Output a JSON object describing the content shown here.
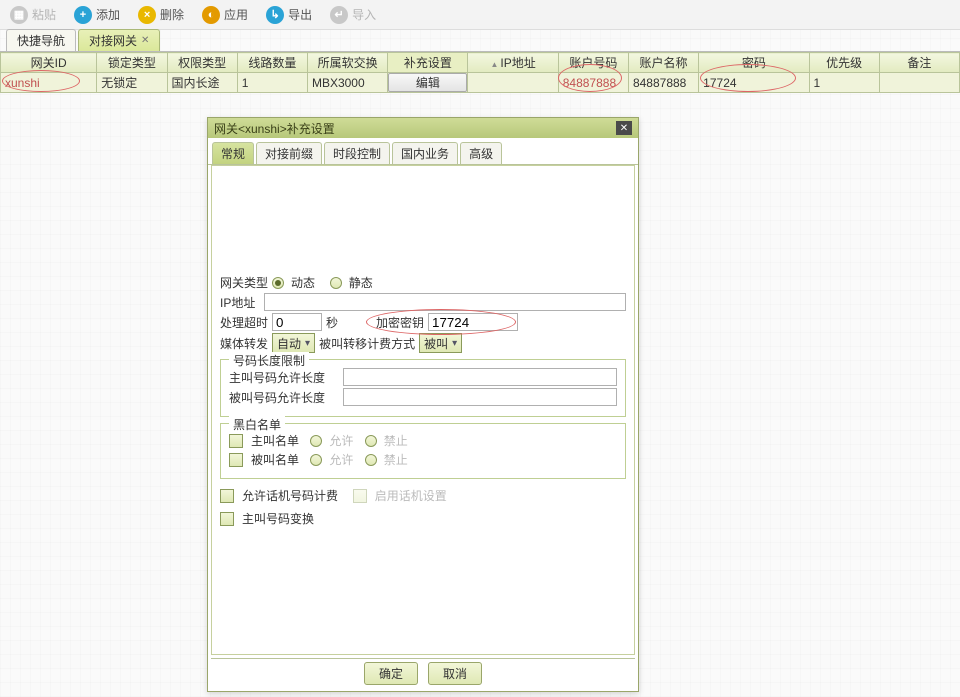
{
  "toolbar": {
    "paste": "粘贴",
    "add": "添加",
    "delete": "删除",
    "apply": "应用",
    "export": "导出",
    "import": "导入"
  },
  "tabs": {
    "quickNav": "快捷导航",
    "gateway": "对接网关"
  },
  "grid": {
    "headers": {
      "gatewayId": "网关ID",
      "lockType": "锁定类型",
      "permType": "权限类型",
      "lineCount": "线路数量",
      "softswitch": "所属软交换",
      "extra": "补充设置",
      "ip": "IP地址",
      "acctNum": "账户号码",
      "acctName": "账户名称",
      "password": "密码",
      "priority": "优先级",
      "remark": "备注"
    },
    "row": {
      "gatewayId": "xunshi",
      "lockType": "无锁定",
      "permType": "国内长途",
      "lineCount": "1",
      "softswitch": "MBX3000",
      "extraBtn": "编辑",
      "ip": "",
      "acctNum": "84887888",
      "acctName": "84887888",
      "password": "17724",
      "priority": "1",
      "remark": ""
    }
  },
  "dialog": {
    "title": "网关<xunshi>补充设置",
    "tabs": {
      "general": "常规",
      "prefix": "对接前缀",
      "period": "时段控制",
      "domestic": "国内业务",
      "advanced": "高级"
    },
    "form": {
      "gwTypeLabel": "网关类型",
      "gwTypeDynamic": "动态",
      "gwTypeStatic": "静态",
      "ipLabel": "IP地址",
      "ipValue": "",
      "timeoutLabel": "处理超时",
      "timeoutValue": "0",
      "timeoutUnit": "秒",
      "keyLabel": "加密密钥",
      "keyValue": "17724",
      "mediaRelayLabel": "媒体转发",
      "mediaRelayValue": "自动",
      "transferBillLabel": "被叫转移计费方式",
      "transferBillValue": "被叫",
      "lenLimitLegend": "号码长度限制",
      "callerLenLabel": "主叫号码允许长度",
      "callerLenValue": "",
      "calleeLenLabel": "被叫号码允许长度",
      "calleeLenValue": "",
      "bwLegend": "黑白名单",
      "callerList": "主叫名单",
      "calleeList": "被叫名单",
      "allow": "允许",
      "deny": "禁止",
      "allowPhoneBilling": "允许话机号码计费",
      "enablePhoneCfg": "启用话机设置",
      "callerTransform": "主叫号码变换"
    },
    "buttons": {
      "ok": "确定",
      "cancel": "取消"
    }
  }
}
